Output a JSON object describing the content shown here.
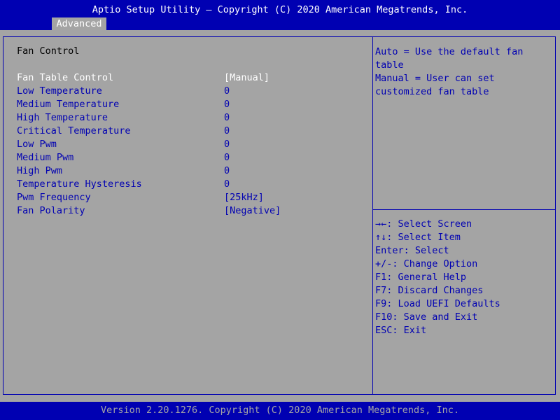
{
  "header": {
    "title": "Aptio Setup Utility – Copyright (C) 2020 American Megatrends, Inc.",
    "active_tab": "Advanced"
  },
  "main": {
    "section_title": "Fan Control",
    "settings": [
      {
        "label": "Fan Table Control",
        "value": "[Manual]"
      },
      {
        "label": "Low Temperature",
        "value": "0"
      },
      {
        "label": "Medium Temperature",
        "value": "0"
      },
      {
        "label": "High Temperature",
        "value": "0"
      },
      {
        "label": "Critical Temperature",
        "value": "0"
      },
      {
        "label": "Low Pwm",
        "value": "0"
      },
      {
        "label": "Medium Pwm",
        "value": "0"
      },
      {
        "label": "High Pwm",
        "value": "0"
      },
      {
        "label": "Temperature Hysteresis",
        "value": "0"
      },
      {
        "label": "Pwm Frequency",
        "value": "[25kHz]"
      },
      {
        "label": "Fan Polarity",
        "value": "[Negative]"
      }
    ]
  },
  "help": {
    "lines": [
      "Auto = Use the default fan",
      "table",
      "Manual = User can set",
      "customized fan table"
    ]
  },
  "keys": [
    "→←: Select Screen",
    "↑↓: Select Item",
    "Enter: Select",
    "+/-: Change Option",
    "F1: General Help",
    "F7: Discard Changes",
    "F9: Load UEFI Defaults",
    "F10: Save and Exit",
    "ESC: Exit"
  ],
  "footer": {
    "version": "Version 2.20.1276. Copyright (C) 2020 American Megatrends, Inc."
  },
  "colors": {
    "background": "#a4a4a4",
    "bar": "#0000b2",
    "selected_text": "#ffffff"
  }
}
